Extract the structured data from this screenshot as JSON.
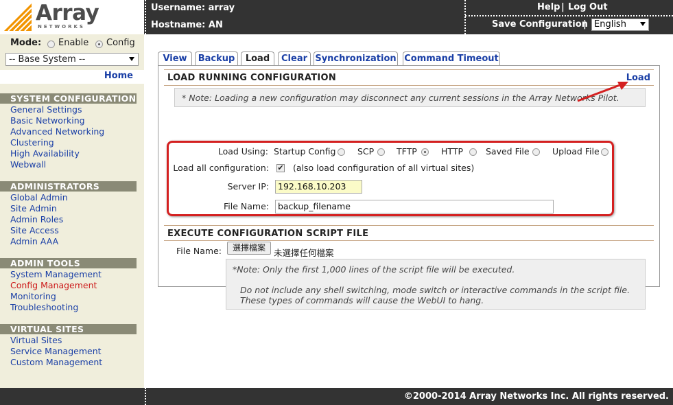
{
  "header": {
    "logo_text": "Array",
    "logo_sub": "NETWORKS",
    "username": "Username: array",
    "hostname": "Hostname: AN",
    "help": "Help",
    "logout": "Log Out",
    "separator": "|",
    "save_config": "Save Configuration",
    "language": "English"
  },
  "sidebar": {
    "mode_label": "Mode:",
    "mode_enable": "Enable",
    "mode_config": "Config",
    "system_select": "-- Base System --",
    "home": "Home",
    "sections": [
      {
        "title": "SYSTEM CONFIGURATION",
        "items": [
          "General Settings",
          "Basic Networking",
          "Advanced Networking",
          "Clustering",
          "High Availability",
          "Webwall"
        ]
      },
      {
        "title": "ADMINISTRATORS",
        "items": [
          "Global Admin",
          "Site Admin",
          "Admin Roles",
          "Site Access",
          "Admin AAA"
        ]
      },
      {
        "title": "ADMIN TOOLS",
        "items": [
          "System Management",
          "Config Management",
          "Monitoring",
          "Troubleshooting"
        ]
      },
      {
        "title": "VIRTUAL SITES",
        "items": [
          "Virtual Sites",
          "Service Management",
          "Custom Management"
        ]
      }
    ]
  },
  "tabs": [
    "View",
    "Backup",
    "Load",
    "Clear",
    "Synchronization",
    "Command Timeout"
  ],
  "load_section": {
    "title": "LOAD RUNNING CONFIGURATION",
    "action": "Load",
    "note": "* Note: Loading a new configuration may disconnect any current sessions in the Array Networks Pilot.",
    "load_using_label": "Load Using:",
    "options": [
      "Startup Config",
      "SCP",
      "TFTP",
      "HTTP",
      "Saved File",
      "Upload File"
    ],
    "selected_option": "TFTP",
    "load_all_label": "Load all configuration:",
    "load_all_note": "(also load configuration of all virtual sites)",
    "load_all_checked": true,
    "server_ip_label": "Server IP:",
    "server_ip": "192.168.10.203",
    "file_name_label": "File Name:",
    "file_name": "backup_filename"
  },
  "script_section": {
    "title": "EXECUTE CONFIGURATION SCRIPT FILE",
    "file_name_label": "File Name:",
    "choose_button": "選擇檔案",
    "no_file": "未選擇任何檔案",
    "note_line1": "*Note: Only the first 1,000 lines of the script file will be executed.",
    "note_line2": "Do not include any shell switching, mode switch or interactive commands in the script file.",
    "note_line3": "These types of commands will cause the WebUI to hang."
  },
  "footer": {
    "copyright": "©2000-2014 Array Networks Inc. All rights reserved."
  },
  "colors": {
    "accent_red": "#d42020",
    "link_blue": "#1a3fa6",
    "header_bg": "#333333",
    "sidebar_bg": "#f0eedc",
    "logo_orange": "#f29400"
  }
}
